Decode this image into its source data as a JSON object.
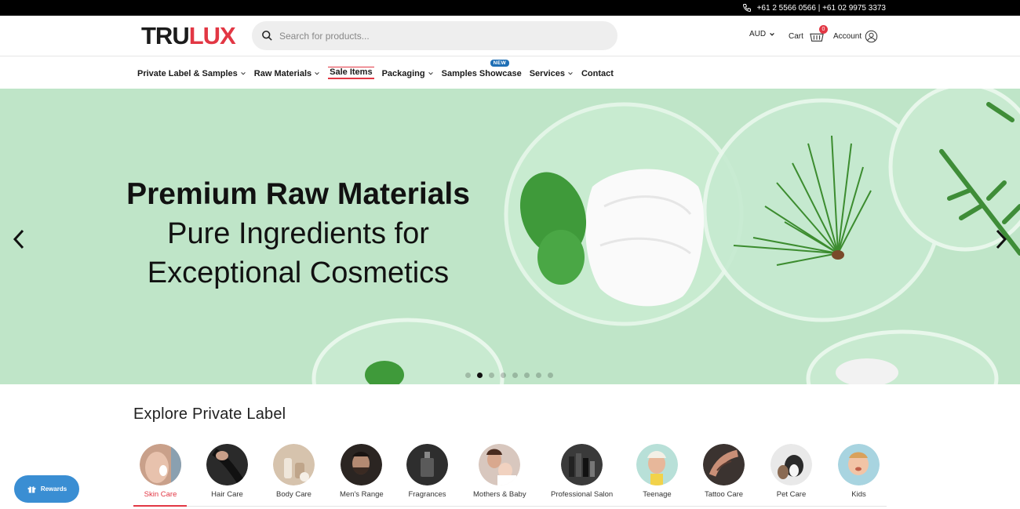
{
  "topbar": {
    "phone": "+61 2 5566 0566 | +61 02 9975 3373"
  },
  "header": {
    "logo_part1": "TRU",
    "logo_part2": "LUX",
    "search_placeholder": "Search for products...",
    "currency": "AUD",
    "cart_label": "Cart",
    "cart_count": "0",
    "account_label": "Account"
  },
  "nav": {
    "items": [
      {
        "label": "Private Label & Samples"
      },
      {
        "label": "Raw Materials"
      },
      {
        "label": "Sale Items"
      },
      {
        "label": "Packaging"
      },
      {
        "label": "Samples Showcase"
      },
      {
        "label": "Services"
      },
      {
        "label": "Contact"
      }
    ],
    "new_badge": "NEW"
  },
  "hero": {
    "line1": "Premium Raw Materials",
    "line2": "Pure Ingredients for",
    "line3": "Exceptional Cosmetics",
    "slide_count": 8,
    "active_slide": 2
  },
  "explore": {
    "title": "Explore Private Label",
    "categories": [
      {
        "label": "Skin Care"
      },
      {
        "label": "Hair Care"
      },
      {
        "label": "Body Care"
      },
      {
        "label": "Men's Range"
      },
      {
        "label": "Fragrances"
      },
      {
        "label": "Mothers & Baby"
      },
      {
        "label": "Professional Salon"
      },
      {
        "label": "Teenage"
      },
      {
        "label": "Tattoo Care"
      },
      {
        "label": "Pet Care"
      },
      {
        "label": "Kids"
      }
    ],
    "active_category": "Skin Care"
  },
  "rewards": {
    "label": "Rewards"
  },
  "colors": {
    "brand_red": "#e23744",
    "rewards_blue": "#3a8ed3",
    "hero_green": "#bfe5c8"
  }
}
